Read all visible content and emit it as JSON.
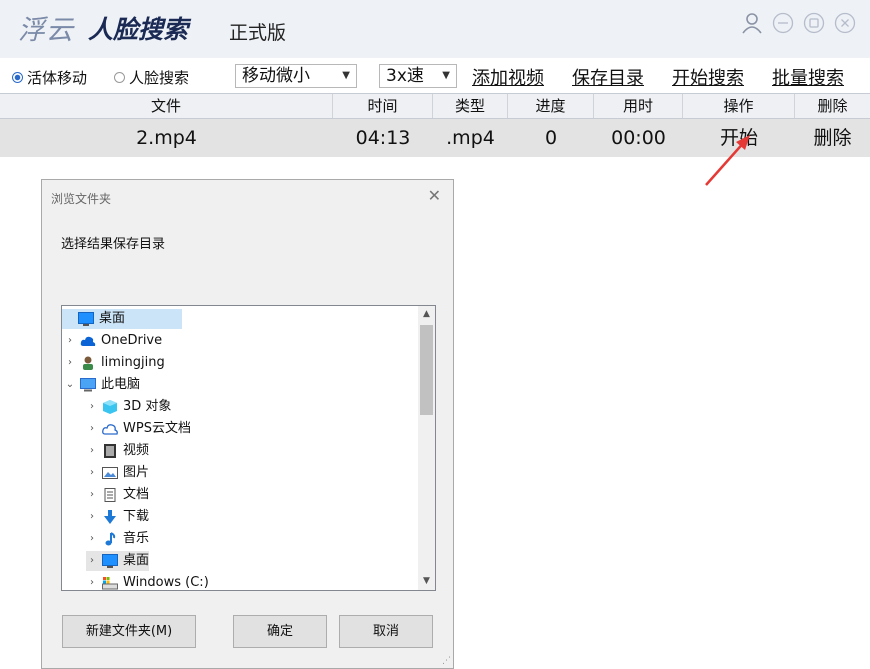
{
  "app": {
    "brand_light": "浮云",
    "brand_bold": "人脸搜索",
    "edition": "正式版"
  },
  "toolbar": {
    "mode_options": [
      {
        "label": "活体移动",
        "selected": true
      },
      {
        "label": "人脸搜索",
        "selected": false
      }
    ],
    "sensitivity_value": "移动微小",
    "speed_value": "3x速",
    "add_video": "添加视频",
    "save_dir": "保存目录",
    "start_search": "开始搜索",
    "batch_search": "批量搜索"
  },
  "table": {
    "columns": [
      "文件",
      "时间",
      "类型",
      "进度",
      "用时",
      "操作",
      "删除"
    ],
    "rows": [
      {
        "file": "2.mp4",
        "time": "04:13",
        "type": ".mp4",
        "progress": "0",
        "elapsed": "00:00",
        "action": "开始",
        "delete": "删除"
      }
    ]
  },
  "dialog": {
    "title": "浏览文件夹",
    "description": "选择结果保存目录",
    "tree": [
      {
        "label": "桌面",
        "icon": "desktop-icon",
        "level": 0,
        "chevron": "",
        "selected": "blue"
      },
      {
        "label": "OneDrive",
        "icon": "cloud-icon",
        "level": 0,
        "chevron": "›"
      },
      {
        "label": "limingjing",
        "icon": "user-icon",
        "level": 0,
        "chevron": "›"
      },
      {
        "label": "此电脑",
        "icon": "computer-icon",
        "level": 0,
        "chevron": "⌄"
      },
      {
        "label": "3D 对象",
        "icon": "cube-icon",
        "level": 1,
        "chevron": "›"
      },
      {
        "label": "WPS云文档",
        "icon": "wps-cloud-icon",
        "level": 1,
        "chevron": "›"
      },
      {
        "label": "视频",
        "icon": "video-icon",
        "level": 1,
        "chevron": "›"
      },
      {
        "label": "图片",
        "icon": "picture-icon",
        "level": 1,
        "chevron": "›"
      },
      {
        "label": "文档",
        "icon": "document-icon",
        "level": 1,
        "chevron": "›"
      },
      {
        "label": "下载",
        "icon": "download-icon",
        "level": 1,
        "chevron": "›"
      },
      {
        "label": "音乐",
        "icon": "music-icon",
        "level": 1,
        "chevron": "›"
      },
      {
        "label": "桌面",
        "icon": "desktop-icon",
        "level": 1,
        "chevron": "›",
        "selected": "grey"
      },
      {
        "label": "Windows (C:)",
        "icon": "drive-icon",
        "level": 1,
        "chevron": "›"
      }
    ],
    "new_folder": "新建文件夹(M)",
    "ok": "确定",
    "cancel": "取消"
  },
  "colors": {
    "accent": "#2a6acb",
    "annotation": "#e53935"
  }
}
